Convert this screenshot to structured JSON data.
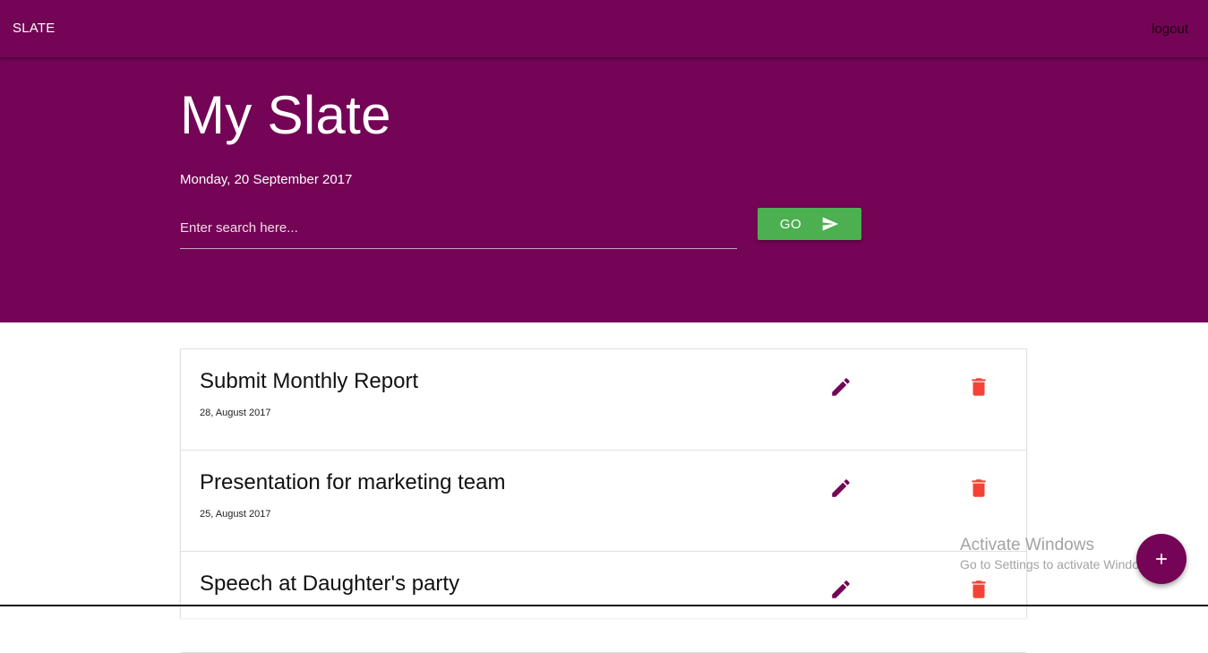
{
  "navbar": {
    "brand": "SLATE",
    "logout_label": "logout"
  },
  "hero": {
    "title": "My Slate",
    "date": "Monday, 20 September 2017",
    "search": {
      "placeholder": "Enter search here...",
      "value": ""
    },
    "go_label": "GO",
    "go_icon": "send-icon"
  },
  "tasks": [
    {
      "title": "Submit Monthly Report",
      "date": "28, August 2017"
    },
    {
      "title": "Presentation for marketing team",
      "date": "25, August 2017"
    },
    {
      "title": "Speech at Daughter's party",
      "date": ""
    }
  ],
  "task_icons": {
    "edit": "pencil-icon",
    "delete": "trash-icon"
  },
  "fab": {
    "icon": "plus-icon"
  },
  "watermark": {
    "line1": "Activate Windows",
    "line2": "Go to Settings to activate Windows."
  },
  "colors": {
    "primary": "#740455",
    "go_button": "#4caf50",
    "edit_icon": "#740455",
    "delete_icon": "#f44336"
  }
}
